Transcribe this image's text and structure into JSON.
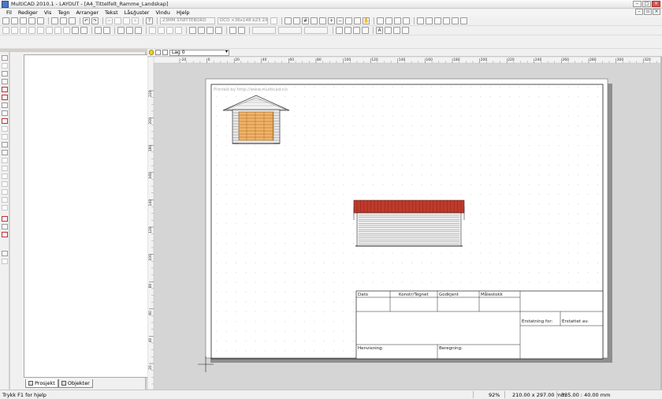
{
  "window": {
    "title": "MultiCAD 2010.1 - LAYOUT - [A4_Tittelfelt_Ramme_Landskap]"
  },
  "menu": [
    "Fil",
    "Rediger",
    "Vis",
    "Tegn",
    "Arranger",
    "Tekst",
    "Lås/Juster",
    "Vindu",
    "Hjelp"
  ],
  "toolbar": {
    "combo1": "23MM STØTTEBORD",
    "combo2": "DCO ×36x148 b23 2X"
  },
  "layer": {
    "name": "Lag 0"
  },
  "rulers": {
    "top": [
      "-20",
      "0",
      "20",
      "40",
      "60",
      "80",
      "100",
      "120",
      "140",
      "160",
      "180",
      "200",
      "220",
      "240",
      "260",
      "280",
      "300",
      "320"
    ],
    "left": [
      "220",
      "200",
      "180",
      "160",
      "140",
      "120",
      "100",
      "80",
      "60",
      "40",
      "20",
      "0"
    ]
  },
  "drawing": {
    "watermark": "Printed by http://www.multicad.no",
    "title_block": {
      "dato": "Dato",
      "konstr": "Konstr/Tegnet",
      "godkjent": "Godkjent",
      "malestokk": "Målestokk",
      "erstatning_for": "Erstatning for:",
      "erstattet_av": "Erstattet av:",
      "henvisning": "Henvisning:",
      "beregning": "Beregning:"
    }
  },
  "panel": {
    "tabs": [
      "Prosjekt",
      "Objekter"
    ]
  },
  "status": {
    "hint": "Trykk F1 for hjelp",
    "zoom": "92%",
    "paper": "210.00 x 297.00 mm",
    "coords": "335.00 : 40.00 mm"
  }
}
